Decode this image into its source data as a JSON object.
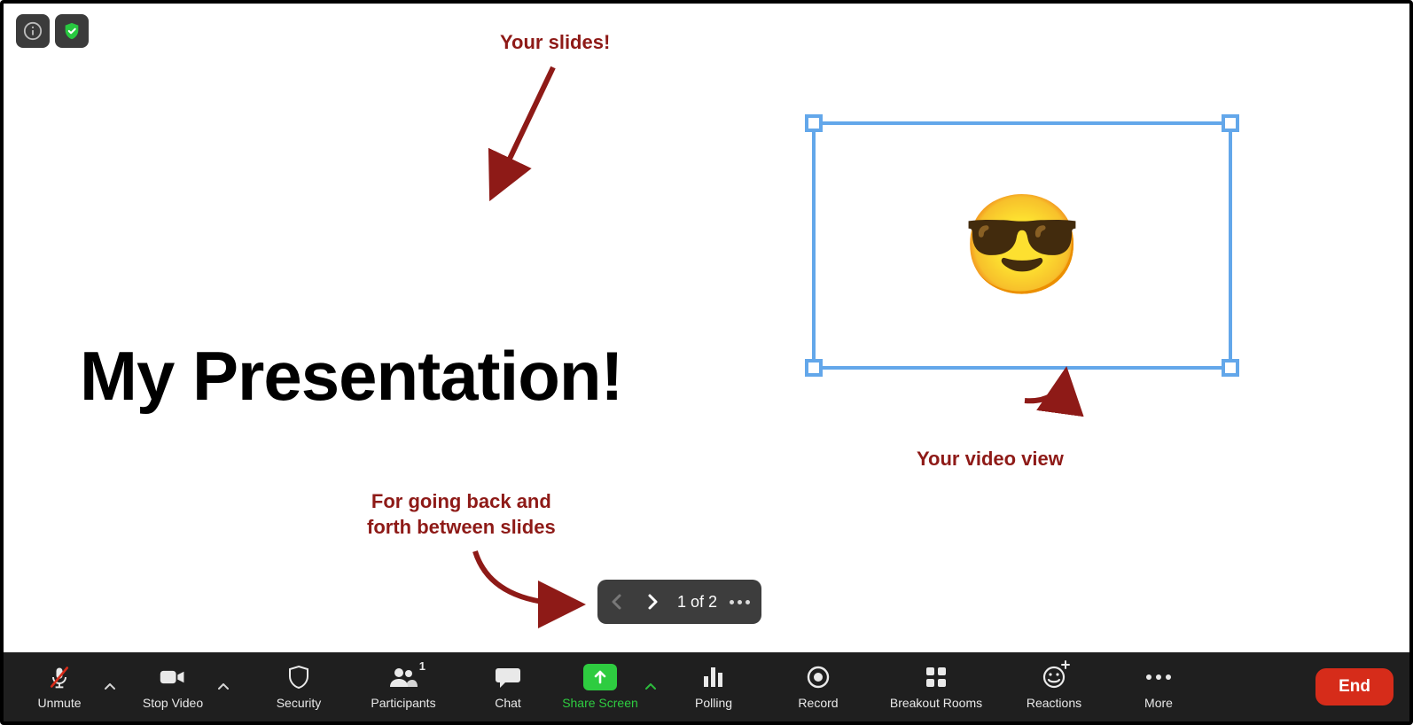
{
  "slide": {
    "title": "My Presentation!"
  },
  "videoView": {
    "emoji": "😎"
  },
  "annotations": {
    "slides": "Your slides!",
    "video": "Your video view",
    "nav_line1": "For going back and",
    "nav_line2": "forth between slides"
  },
  "slideNav": {
    "counter": "1 of 2"
  },
  "topBadges": {
    "info": "info-icon",
    "encryption": "shield-check-icon"
  },
  "toolbar": {
    "unmute": "Unmute",
    "stop_video": "Stop Video",
    "security": "Security",
    "participants": "Participants",
    "participants_count": "1",
    "chat": "Chat",
    "share_screen": "Share Screen",
    "polling": "Polling",
    "record": "Record",
    "breakout": "Breakout Rooms",
    "reactions": "Reactions",
    "more": "More",
    "end": "End"
  },
  "colors": {
    "annotation": "#8e1a17",
    "selection": "#63a7ea",
    "share_green": "#2ecc40",
    "end_red": "#d62c1a",
    "toolbar_bg": "#1f1f1f"
  }
}
